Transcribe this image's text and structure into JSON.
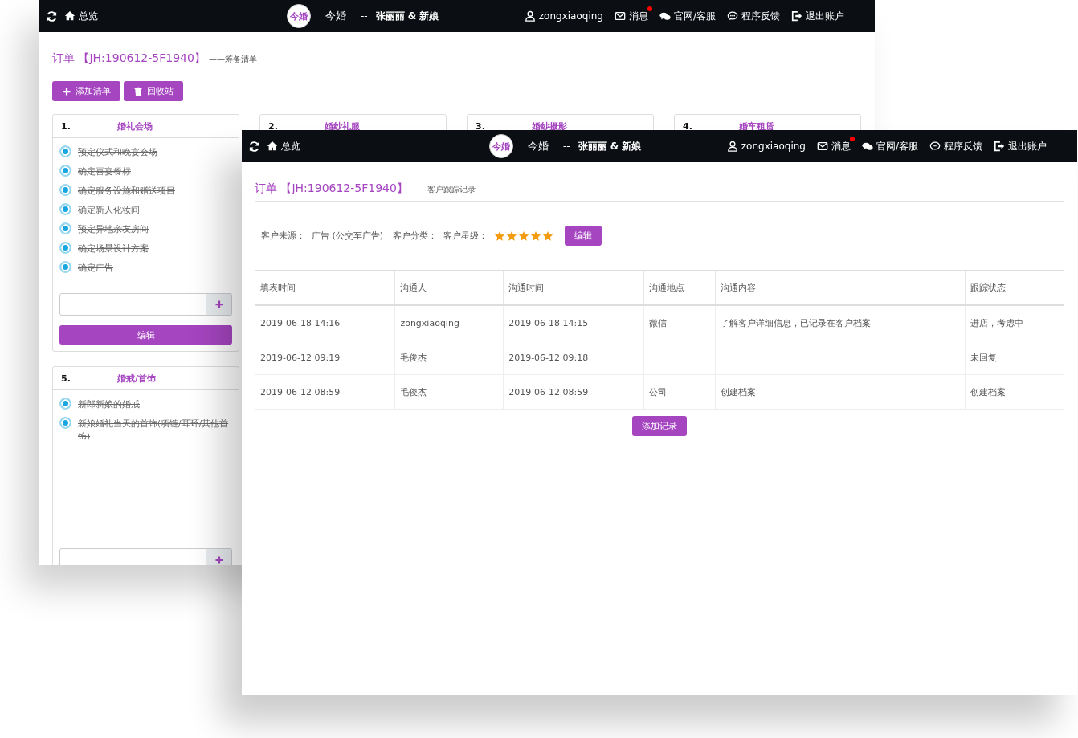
{
  "windows": [
    {
      "nav": {
        "home": "总览",
        "logo": "今婚",
        "brand": "今婚",
        "couple_prefix": "--",
        "couple": "张丽丽 & 新娘",
        "user": "zongxiaoqing",
        "messages": "消息",
        "unread": true,
        "support": "官网/客服",
        "feedback": "程序反馈",
        "logout": "退出账户"
      },
      "heading": {
        "order": "订单 【JH:190612-5F1940】",
        "subtitle": "——筹备清单"
      },
      "actions": [
        {
          "label": "添加清单",
          "kind": "add"
        },
        {
          "label": "回收站",
          "kind": "trash"
        }
      ],
      "cards": [
        {
          "number": "1.",
          "title": "婚礼会场",
          "items": [
            {
              "text": "预定仪式和晚宴会场",
              "checked": true
            },
            {
              "text": "确定喜宴餐标",
              "checked": true
            },
            {
              "text": "确定服务设施和赠送项目",
              "checked": true
            },
            {
              "text": "确定新人化妆间",
              "checked": true
            },
            {
              "text": "预定异地亲友房间",
              "checked": true
            },
            {
              "text": "确定场景设计方案",
              "checked": true
            },
            {
              "text": "确定广告",
              "checked": true
            }
          ],
          "add_field": true,
          "edit": "编辑"
        },
        {
          "number": "2.",
          "title": "婚纱礼服"
        },
        {
          "number": "3.",
          "title": "婚纱摄影"
        },
        {
          "number": "4.",
          "title": "婚车租赁"
        },
        {
          "number": "5.",
          "title": "婚戒/首饰",
          "items": [
            {
              "text": "新郎新娘的婚戒",
              "checked": true
            },
            {
              "text": "新娘婚礼当天的首饰(项链/耳环/其他首饰)",
              "checked": true
            }
          ],
          "add_field": true
        }
      ]
    },
    {
      "nav": {
        "home": "总览",
        "logo": "今婚",
        "brand": "今婚",
        "couple_prefix": "--",
        "couple": "张丽丽 & 新娘",
        "user": "zongxiaoqing",
        "messages": "消息",
        "unread": true,
        "support": "官网/客服",
        "feedback": "程序反馈",
        "logout": "退出账户"
      },
      "heading": {
        "order": "订单 【JH:190612-5F1940】",
        "subtitle": "——客户跟踪记录"
      },
      "customer": {
        "source_label": "客户来源：",
        "source": "广告 (公交车广告)",
        "category_label": "客户分类：",
        "rating_label": "客户星级：",
        "stars": 5,
        "edit": "编辑"
      },
      "table": {
        "columns": [
          "填表时间",
          "沟通人",
          "沟通时间",
          "沟通地点",
          "沟通内容",
          "跟踪状态"
        ],
        "rows": [
          [
            "2019-06-18 14:16",
            "zongxiaoqing",
            "2019-06-18 14:15",
            "微信",
            "了解客户详细信息，已记录在客户档案",
            "进店，考虑中"
          ],
          [
            "2019-06-12 09:19",
            "毛俊杰",
            "2019-06-12 09:18",
            "",
            "",
            "未回复"
          ],
          [
            "2019-06-12 08:59",
            "毛俊杰",
            "2019-06-12 08:59",
            "公司",
            "创建档案",
            "创建档案"
          ]
        ],
        "add": "添加记录"
      }
    }
  ]
}
